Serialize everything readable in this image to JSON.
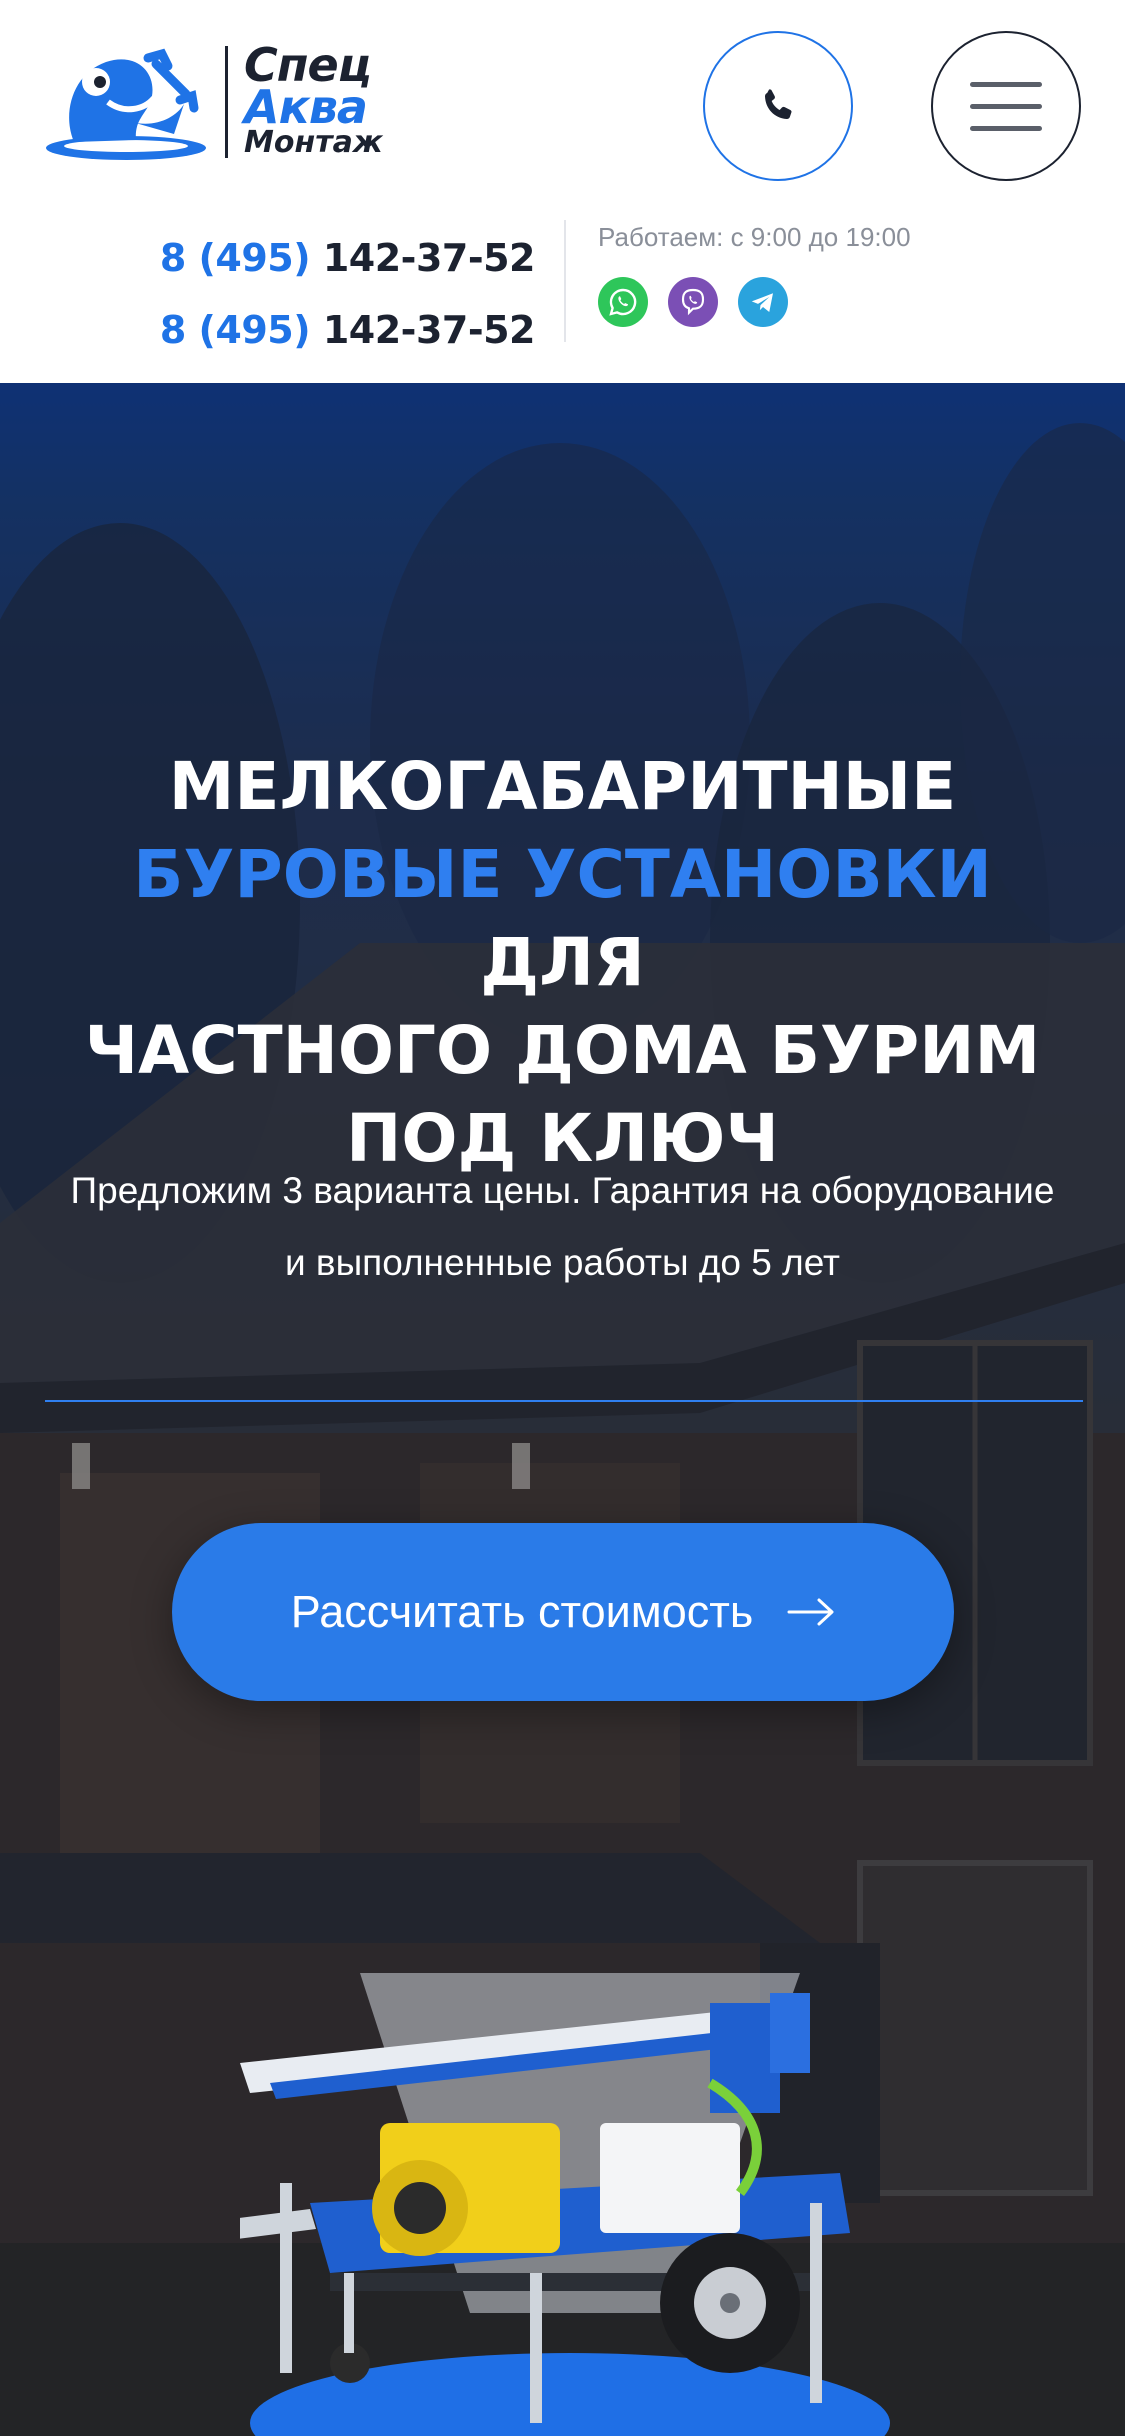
{
  "brand": {
    "line1": "Спец",
    "line2": "Аква",
    "line3": "Монтаж",
    "primary_color": "#1f73e6",
    "dark_color": "#1c2230"
  },
  "header": {
    "phone_icon": "phone-icon",
    "menu_icon": "hamburger-menu-icon",
    "phones": [
      {
        "code": "8 (495)",
        "number": "142-37-52"
      },
      {
        "code": "8 (495)",
        "number": "142-37-52"
      }
    ],
    "hours": "Работаем: с 9:00 до 19:00",
    "socials": [
      "whatsapp-icon",
      "viber-icon",
      "telegram-icon"
    ]
  },
  "hero": {
    "title_line1": "МЕЛКОГАБАРИТНЫЕ",
    "title_accent": "БУРОВЫЕ УСТАНОВКИ",
    "title_after_accent": "ДЛЯ",
    "title_line3": "ЧАСТНОГО ДОМА БУРИМ",
    "title_line4": "ПОД КЛЮЧ",
    "subtitle": "Предложим 3 варианта цены. Гарантия на оборудование и выполненные работы до 5 лет",
    "cta_label": "Рассчитать стоимость",
    "cta_icon": "arrow-right-icon",
    "accent_color": "#2f7ff0"
  }
}
